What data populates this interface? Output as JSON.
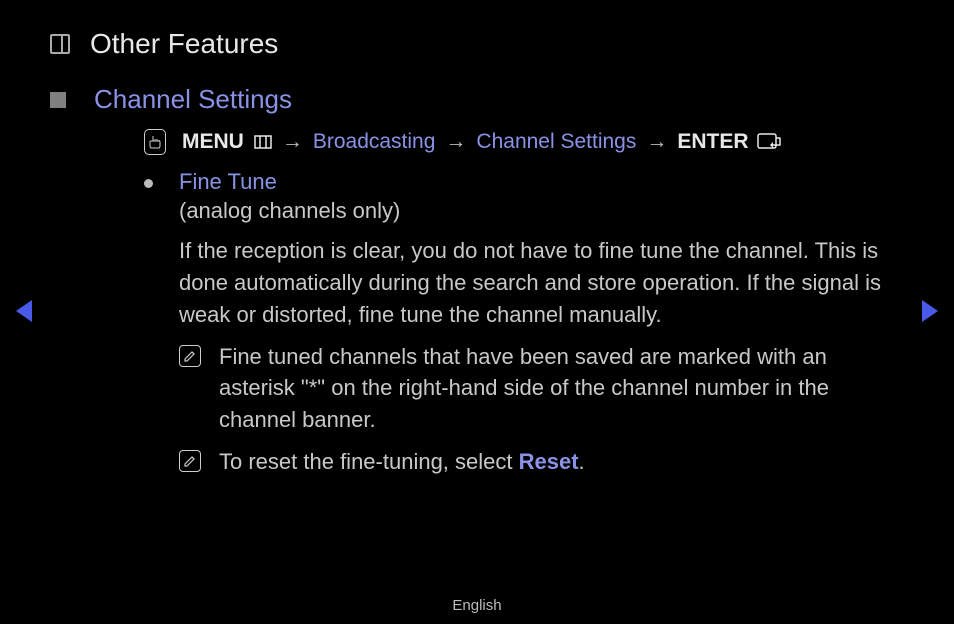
{
  "header": {
    "title": "Other Features"
  },
  "section": {
    "title": "Channel Settings"
  },
  "navpath": {
    "menu": "MENU",
    "broadcasting": "Broadcasting",
    "channel_settings": "Channel Settings",
    "enter": "ENTER",
    "arrow": "→"
  },
  "item": {
    "title": "Fine Tune",
    "subtitle": "(analog channels only)",
    "paragraph": "If the reception is clear, you do not have to fine tune the channel. This is done automatically during the search and store operation. If the signal is weak or distorted, fine tune the channel manually."
  },
  "notes": {
    "note1": "Fine tuned channels that have been saved are marked with an asterisk \"*\" on the right-hand side of the channel number in the channel banner.",
    "note2_prefix": "To reset the fine-tuning, select ",
    "note2_highlight": "Reset",
    "note2_suffix": "."
  },
  "footer": {
    "language": "English"
  }
}
